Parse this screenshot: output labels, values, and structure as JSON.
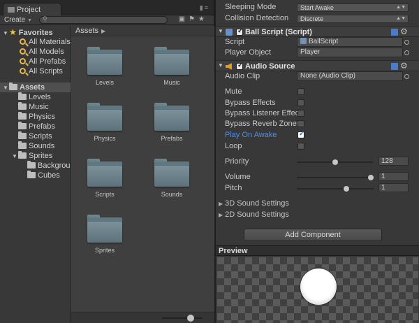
{
  "project": {
    "tab_label": "Project",
    "create_label": "Create",
    "search_placeholder": "",
    "favorites": {
      "label": "Favorites",
      "items": [
        "All Materials",
        "All Models",
        "All Prefabs",
        "All Scripts"
      ]
    },
    "assets_root": "Assets",
    "assets_tree": [
      "Levels",
      "Music",
      "Physics",
      "Prefabs",
      "Scripts",
      "Sounds"
    ],
    "sprites_label": "Sprites",
    "sprites_children": [
      "Backgrou",
      "Cubes"
    ],
    "breadcrumb": "Assets",
    "folders": [
      "Levels",
      "Music",
      "Physics",
      "Prefabs",
      "Scripts",
      "Sounds",
      "Sprites"
    ]
  },
  "inspector": {
    "sleeping_mode": {
      "label": "Sleeping Mode",
      "value": "Start Awake"
    },
    "collision_detection": {
      "label": "Collision Detection",
      "value": "Discrete"
    },
    "ball_script": {
      "title": "Ball Script (Script)",
      "enabled": true,
      "script_label": "Script",
      "script_value": "BallScript",
      "player_label": "Player Object",
      "player_value": "Player"
    },
    "audio_source": {
      "title": "Audio Source",
      "enabled": true,
      "clip_label": "Audio Clip",
      "clip_value": "None (Audio Clip)",
      "toggles": [
        {
          "label": "Mute",
          "checked": false
        },
        {
          "label": "Bypass Effects",
          "checked": false
        },
        {
          "label": "Bypass Listener Effect",
          "checked": false
        },
        {
          "label": "Bypass Reverb Zones",
          "checked": false
        },
        {
          "label": "Play On Awake",
          "checked": true
        },
        {
          "label": "Loop",
          "checked": false
        }
      ],
      "priority": {
        "label": "Priority",
        "value": "128",
        "fraction": 0.5
      },
      "volume": {
        "label": "Volume",
        "value": "1",
        "fraction": 1.0
      },
      "pitch": {
        "label": "Pitch",
        "value": "1",
        "fraction": 0.66
      },
      "sections": [
        "3D Sound Settings",
        "2D Sound Settings"
      ]
    },
    "add_component_label": "Add Component"
  },
  "preview": {
    "title": "Preview"
  },
  "colors": {
    "accent_blue": "#4d8ee8",
    "folder_gold": "#e9b84a"
  }
}
